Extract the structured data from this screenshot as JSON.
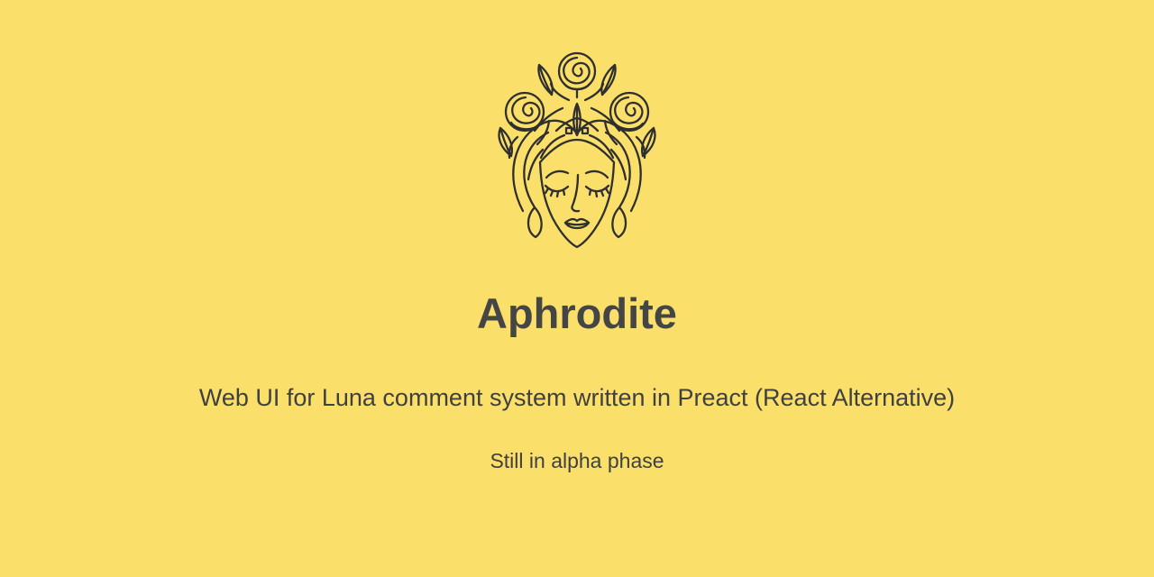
{
  "project": {
    "logo_icon": "woman-face-rose-crown-icon",
    "title": "Aphrodite",
    "description": "Web UI for Luna comment system written in Preact (React Alternative)",
    "status": "Still in alpha phase"
  },
  "colors": {
    "background": "#fae06a",
    "text": "#404040",
    "title": "#454545",
    "line_art": "#2f2f2f"
  }
}
